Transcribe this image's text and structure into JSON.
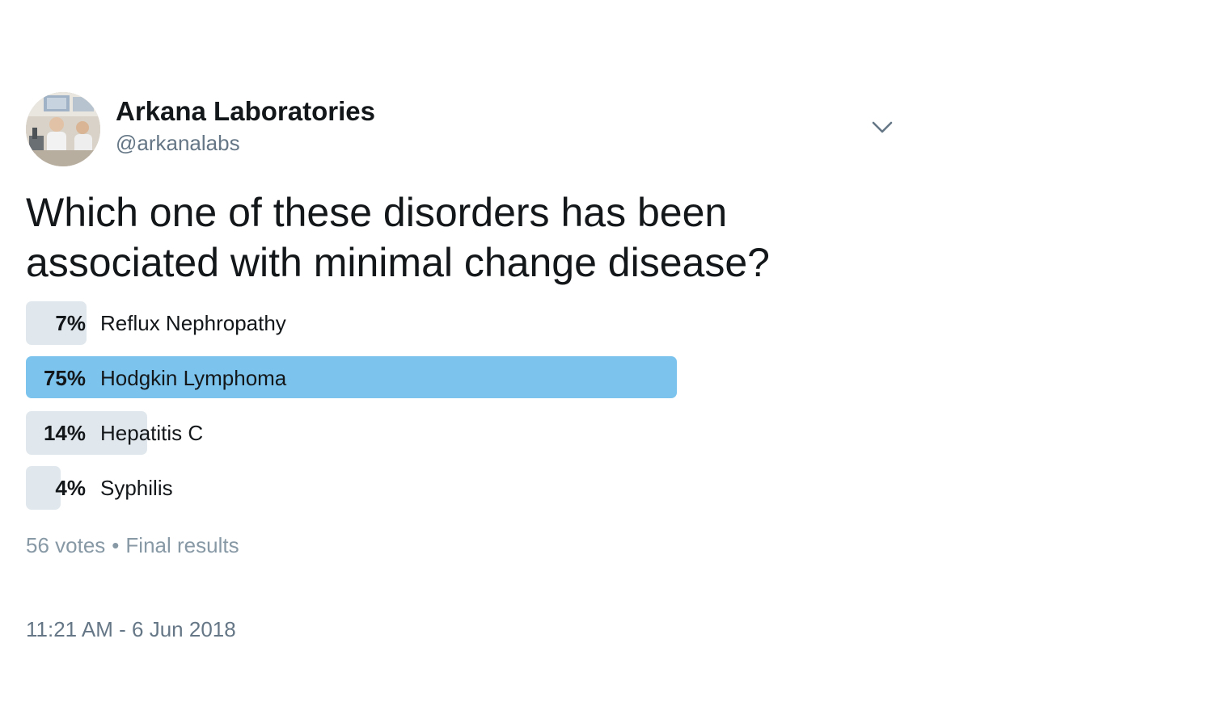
{
  "user": {
    "display_name": "Arkana Laboratories",
    "handle": "@arkanalabs"
  },
  "icons": {
    "more": "chevron-down-icon",
    "avatar": "profile-photo"
  },
  "tweet": {
    "text": "Which one of these disorders has been associated with minimal change disease?"
  },
  "poll": {
    "choices": [
      {
        "percent_label": "7%",
        "percent": 7,
        "label": "Reflux Nephropathy",
        "winner": false
      },
      {
        "percent_label": "75%",
        "percent": 75,
        "label": "Hodgkin Lymphoma",
        "winner": true
      },
      {
        "percent_label": "14%",
        "percent": 14,
        "label": "Hepatitis C",
        "winner": false
      },
      {
        "percent_label": "4%",
        "percent": 4,
        "label": "Syphilis",
        "winner": false
      }
    ],
    "votes": "56 votes",
    "separator": "•",
    "status": "Final results"
  },
  "timestamp": "11:21 AM - 6 Jun 2018",
  "colors": {
    "winner_bar": "#7cc4ed",
    "bar": "#e1e8ed",
    "muted": "#8899a6",
    "secondary": "#657786"
  }
}
